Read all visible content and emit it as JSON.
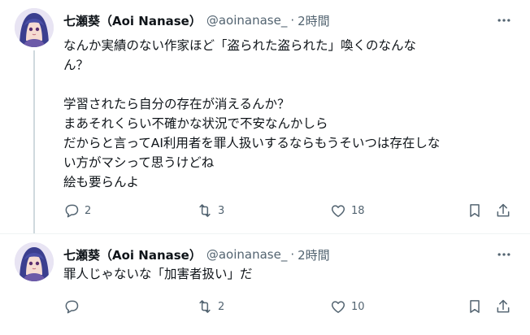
{
  "tweets": [
    {
      "author_name": "七瀬葵（Aoi Nanase）",
      "handle": "@aoinanase_",
      "separator": "·",
      "time": "2時間",
      "text": "なんか実績のない作家ほど「盗られた盗られた」喚くのなんな\nん？\n\n学習されたら自分の存在が消えるんか？\nまあそれくらい不確かな状況で不安なんかしら\nだからと言ってAI利用者を罪人扱いするならもうそいつは存在しな\nい方がマシって思うけどね\n絵も要らんよ",
      "replies": "2",
      "retweets": "3",
      "likes": "18"
    },
    {
      "author_name": "七瀬葵（Aoi Nanase）",
      "handle": "@aoinanase_",
      "separator": "·",
      "time": "2時間",
      "text": "罪人じゃないな「加害者扱い」だ",
      "replies": "",
      "retweets": "2",
      "likes": "10"
    }
  ],
  "colors": {
    "text": "#0f1419",
    "secondary": "#536471",
    "thread_line": "#cfd9de",
    "divider": "#eff3f4"
  },
  "icons": [
    "avatar",
    "more-icon",
    "reply-icon",
    "retweet-icon",
    "like-icon",
    "bookmark-icon",
    "share-icon"
  ]
}
